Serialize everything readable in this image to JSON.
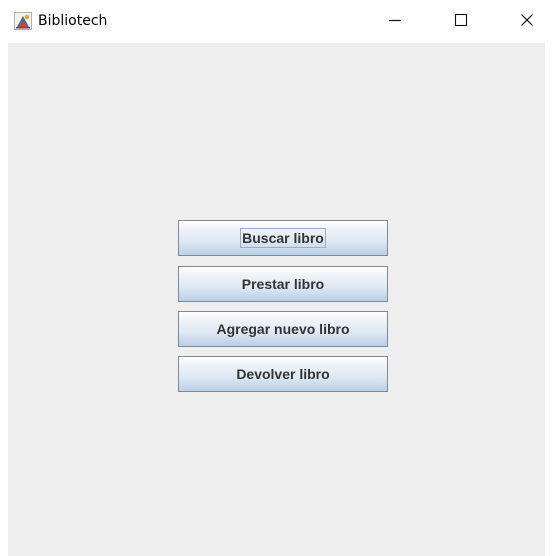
{
  "window": {
    "title": "Bibliotech",
    "app_icon": "java-cup-icon"
  },
  "title_bar_controls": {
    "minimize_icon": "minimize-icon",
    "maximize_icon": "maximize-icon",
    "close_icon": "close-icon"
  },
  "menu": {
    "buttons": [
      {
        "label": "Buscar libro",
        "focused": true
      },
      {
        "label": "Prestar libro",
        "focused": false
      },
      {
        "label": "Agregar nuevo libro",
        "focused": false
      },
      {
        "label": "Devolver libro",
        "focused": false
      }
    ]
  },
  "colors": {
    "content_background": "#eeeeee",
    "button_border": "#7a8a99",
    "button_text": "#333333"
  }
}
